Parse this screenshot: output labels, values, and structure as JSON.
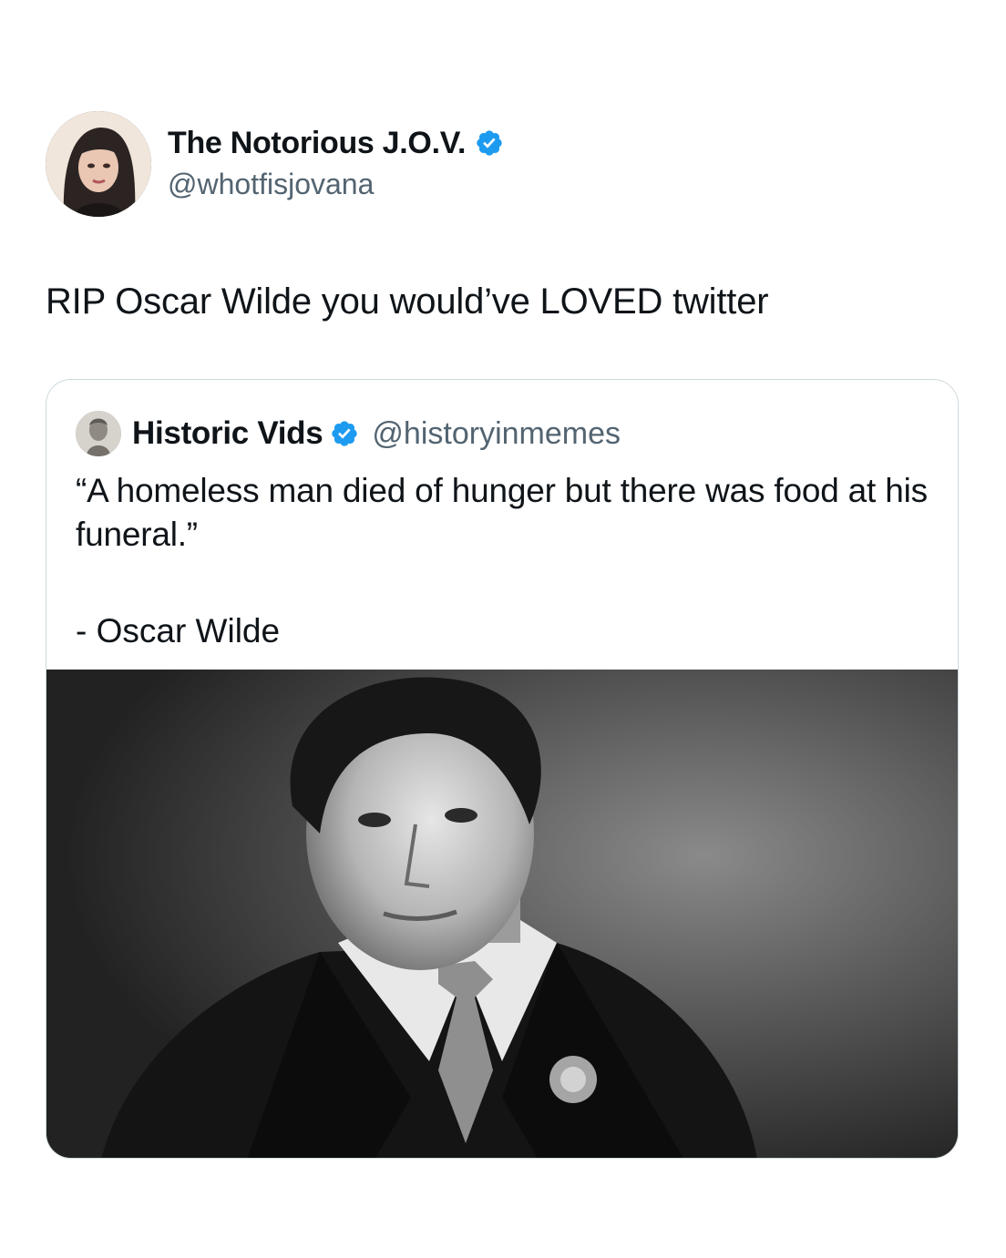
{
  "tweet": {
    "author": {
      "display_name": "The Notorious J.O.V.",
      "handle": "@whotfisjovana",
      "verified": true
    },
    "text": "RIP Oscar Wilde you would’ve LOVED twitter"
  },
  "quoted_tweet": {
    "author": {
      "display_name": "Historic Vids",
      "handle": "@historyinmemes",
      "verified": true
    },
    "quote_text": "“A homeless man died of hunger but there was food at his funeral.”",
    "attribution": "- Oscar Wilde",
    "media": {
      "kind": "black-and-white portrait photo"
    }
  },
  "colors": {
    "primary_text": "#0f1419",
    "secondary_text": "#536471",
    "verified_blue": "#1d9bf0",
    "card_border": "#cfd9de"
  },
  "icons": {
    "verified": "verified-badge-icon"
  }
}
